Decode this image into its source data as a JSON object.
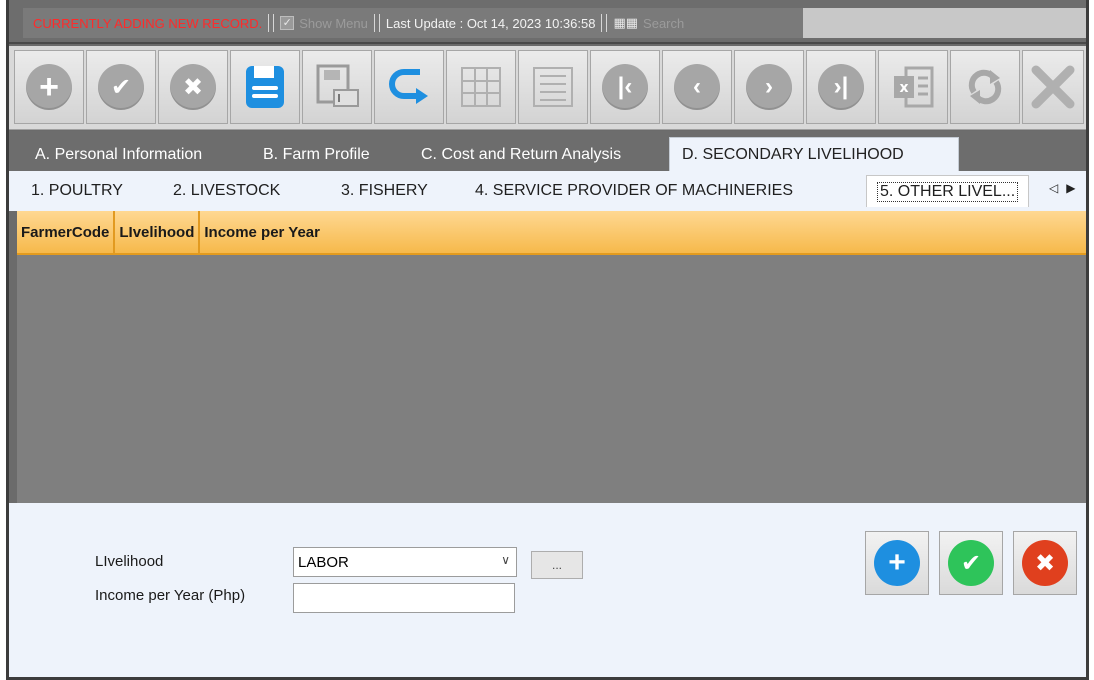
{
  "status": {
    "alert": "CURRENTLY ADDING NEW RECORD.",
    "show_menu": "Show Menu",
    "last_update": "Last Update : Oct 14, 2023 10:36:58",
    "search": "Search"
  },
  "toolbar": {
    "icons": [
      "add-icon",
      "confirm-icon",
      "cancel-icon",
      "save-icon",
      "save-as-icon",
      "undo-icon",
      "grid-icon",
      "list-icon",
      "first-record-icon",
      "previous-record-icon",
      "next-record-icon",
      "last-record-icon",
      "export-excel-icon",
      "refresh-icon",
      "close-icon"
    ],
    "colors": {
      "active_blue": "#1e8fe0",
      "disabled_gray": "#a6a6a6"
    }
  },
  "main_tabs": [
    {
      "label": "A. Personal Information"
    },
    {
      "label": "B. Farm Profile"
    },
    {
      "label": "C. Cost and Return Analysis"
    },
    {
      "label": "D. SECONDARY LIVELIHOOD",
      "active": true
    }
  ],
  "sub_tabs": [
    {
      "label": "1. POULTRY"
    },
    {
      "label": "2. LIVESTOCK"
    },
    {
      "label": "3. FISHERY"
    },
    {
      "label": "4. SERVICE PROVIDER OF MACHINERIES"
    },
    {
      "label": "5. OTHER LIVEL...",
      "active": true
    }
  ],
  "grid": {
    "columns": [
      "FarmerCode",
      "LIvelihood",
      "Income per Year"
    ],
    "rows": [],
    "header_color": "#f6b94b"
  },
  "form": {
    "livelihood_label": "LIvelihood",
    "livelihood_value": "LABOR",
    "ellipsis_label": "...",
    "income_label": "Income per Year (Php)",
    "income_value": "",
    "buttons": {
      "add_color": "#1e8fe0",
      "save_color": "#2ec45a",
      "cancel_color": "#e0401e"
    }
  }
}
